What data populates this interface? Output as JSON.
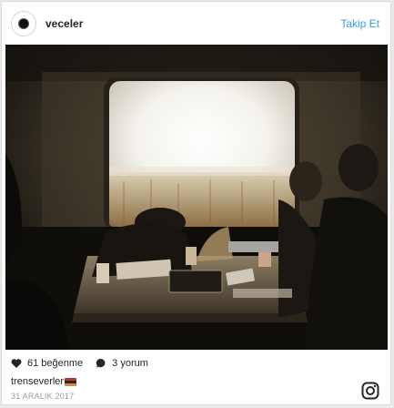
{
  "post": {
    "username": "veceler",
    "follow_label": "Takip Et",
    "photo_description_icon": "photo",
    "likes_text": "61 beğenme",
    "comments_text": "3 yorum",
    "caption_text": "trenseverler",
    "caption_emoji": "flag-icon",
    "date": "31 ARALIK 2017"
  },
  "icons": {
    "like": "heart-icon",
    "comment": "speech-bubble-icon",
    "brand": "instagram-icon"
  },
  "colors": {
    "link": "#3897f0",
    "text": "#262626",
    "muted": "#999999"
  }
}
